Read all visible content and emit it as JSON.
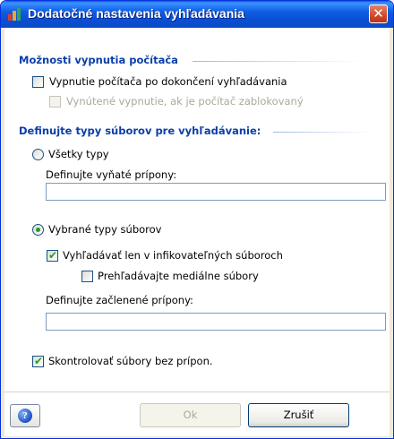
{
  "window": {
    "title": "Dodatočné nastavenia vyhľadávania"
  },
  "shutdown": {
    "heading": "Možnosti vypnutia počítača",
    "option_shutdown": {
      "label": "Vypnutie počítača po dokončení vyhľadávania",
      "checked": false
    },
    "option_forced": {
      "label": "Vynútené vypnutie, ak je počítač zablokovaný",
      "checked": false,
      "enabled": false
    }
  },
  "filetypes": {
    "heading": "Definujte typy súborov pre vyhľadávanie:",
    "all_types": {
      "label": "Všetky typy",
      "selected": false
    },
    "excluded_ext_label": "Definujte vyňaté prípony:",
    "excluded_ext_value": "",
    "selected_types": {
      "label": "Vybrané typy súborov",
      "selected": true
    },
    "infectable_only": {
      "label": "Vyhľadávať len v infikovateľných súboroch",
      "checked": true
    },
    "media_files": {
      "label": "Prehľadávajte mediálne súbory",
      "checked": false
    },
    "included_ext_label": "Definujte začlenené prípony:",
    "included_ext_value": "",
    "no_ext": {
      "label": "Skontrolovať súbory bez prípon.",
      "checked": true
    }
  },
  "footer": {
    "ok_label": "Ok",
    "cancel_label": "Zrušiť",
    "help_glyph": "?"
  }
}
